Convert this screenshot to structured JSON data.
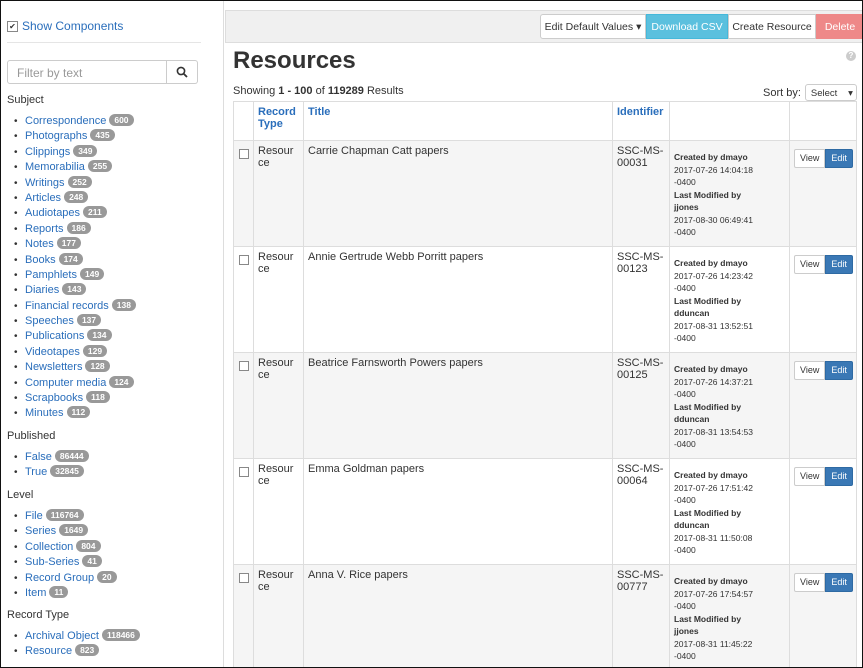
{
  "sidebar": {
    "show_components": "Show Components",
    "filter_placeholder": "Filter by text",
    "facets": [
      {
        "heading": "Subject",
        "items": [
          {
            "label": "Correspondence",
            "count": "600"
          },
          {
            "label": "Photographs",
            "count": "435"
          },
          {
            "label": "Clippings",
            "count": "349"
          },
          {
            "label": "Memorabilia",
            "count": "255"
          },
          {
            "label": "Writings",
            "count": "252"
          },
          {
            "label": "Articles",
            "count": "248"
          },
          {
            "label": "Audiotapes",
            "count": "211"
          },
          {
            "label": "Reports",
            "count": "186"
          },
          {
            "label": "Notes",
            "count": "177"
          },
          {
            "label": "Books",
            "count": "174"
          },
          {
            "label": "Pamphlets",
            "count": "149"
          },
          {
            "label": "Diaries",
            "count": "143"
          },
          {
            "label": "Financial records",
            "count": "138"
          },
          {
            "label": "Speeches",
            "count": "137"
          },
          {
            "label": "Publications",
            "count": "134"
          },
          {
            "label": "Videotapes",
            "count": "129"
          },
          {
            "label": "Newsletters",
            "count": "128"
          },
          {
            "label": "Computer media",
            "count": "124"
          },
          {
            "label": "Scrapbooks",
            "count": "118"
          },
          {
            "label": "Minutes",
            "count": "112"
          }
        ]
      },
      {
        "heading": "Published",
        "items": [
          {
            "label": "False",
            "count": "86444"
          },
          {
            "label": "True",
            "count": "32845"
          }
        ]
      },
      {
        "heading": "Level",
        "items": [
          {
            "label": "File",
            "count": "116764"
          },
          {
            "label": "Series",
            "count": "1649"
          },
          {
            "label": "Collection",
            "count": "804"
          },
          {
            "label": "Sub-Series",
            "count": "41"
          },
          {
            "label": "Record Group",
            "count": "20"
          },
          {
            "label": "Item",
            "count": "11"
          }
        ]
      },
      {
        "heading": "Record Type",
        "items": [
          {
            "label": "Archival Object",
            "count": "118466"
          },
          {
            "label": "Resource",
            "count": "823"
          }
        ]
      }
    ]
  },
  "toolbar": {
    "edit_defaults": "Edit Default Values",
    "download_csv": "Download CSV",
    "create_resource": "Create Resource",
    "delete": "Delete"
  },
  "main": {
    "title": "Resources",
    "showing_prefix": "Showing ",
    "range": "1 - 100",
    "of": " of ",
    "total": "119289",
    "results": " Results",
    "sort_by": "Sort by:",
    "sort_select": "Select",
    "columns": {
      "record_type_1": "Record",
      "record_type_2": "Type",
      "title": "Title",
      "identifier": "Identifier"
    },
    "rows": [
      {
        "type_1": "Resour",
        "type_2": "ce",
        "title": "Carrie Chapman Catt papers",
        "id_1": "SSC-MS-",
        "id_2": "00031",
        "created_by": "Created by dmayo",
        "created_at": "2017-07-26 14:04:18",
        "created_tz": "-0400",
        "modified_label": "Last Modified by",
        "modified_by": "jjones",
        "modified_at": "2017-08-30 06:49:41",
        "modified_tz": "-0400"
      },
      {
        "type_1": "Resour",
        "type_2": "ce",
        "title": "Annie Gertrude Webb Porritt papers",
        "id_1": "SSC-MS-",
        "id_2": "00123",
        "created_by": "Created by dmayo",
        "created_at": "2017-07-26 14:23:42",
        "created_tz": "-0400",
        "modified_label": "Last Modified by",
        "modified_by": "dduncan",
        "modified_at": "2017-08-31 13:52:51",
        "modified_tz": "-0400"
      },
      {
        "type_1": "Resour",
        "type_2": "ce",
        "title": "Beatrice Farnsworth Powers papers",
        "id_1": "SSC-MS-",
        "id_2": "00125",
        "created_by": "Created by dmayo",
        "created_at": "2017-07-26 14:37:21",
        "created_tz": "-0400",
        "modified_label": "Last Modified by",
        "modified_by": "dduncan",
        "modified_at": "2017-08-31 13:54:53",
        "modified_tz": "-0400"
      },
      {
        "type_1": "Resour",
        "type_2": "ce",
        "title": "Emma Goldman papers",
        "id_1": "SSC-MS-",
        "id_2": "00064",
        "created_by": "Created by dmayo",
        "created_at": "2017-07-26 17:51:42",
        "created_tz": "-0400",
        "modified_label": "Last Modified by",
        "modified_by": "dduncan",
        "modified_at": "2017-08-31 11:50:08",
        "modified_tz": "-0400"
      },
      {
        "type_1": "Resour",
        "type_2": "ce",
        "title": "Anna V. Rice papers",
        "id_1": "SSC-MS-",
        "id_2": "00777",
        "created_by": "Created by dmayo",
        "created_at": "2017-07-26 17:54:57",
        "created_tz": "-0400",
        "modified_label": "Last Modified by",
        "modified_by": "jjones",
        "modified_at": "2017-08-31 11:45:22",
        "modified_tz": "-0400"
      }
    ],
    "view_label": "View",
    "edit_label": "Edit"
  },
  "colors": {
    "link": "#2a6ebb",
    "csv": "#5bc0de",
    "delete": "#e88",
    "edit": "#3a78b5",
    "badge": "#999"
  }
}
